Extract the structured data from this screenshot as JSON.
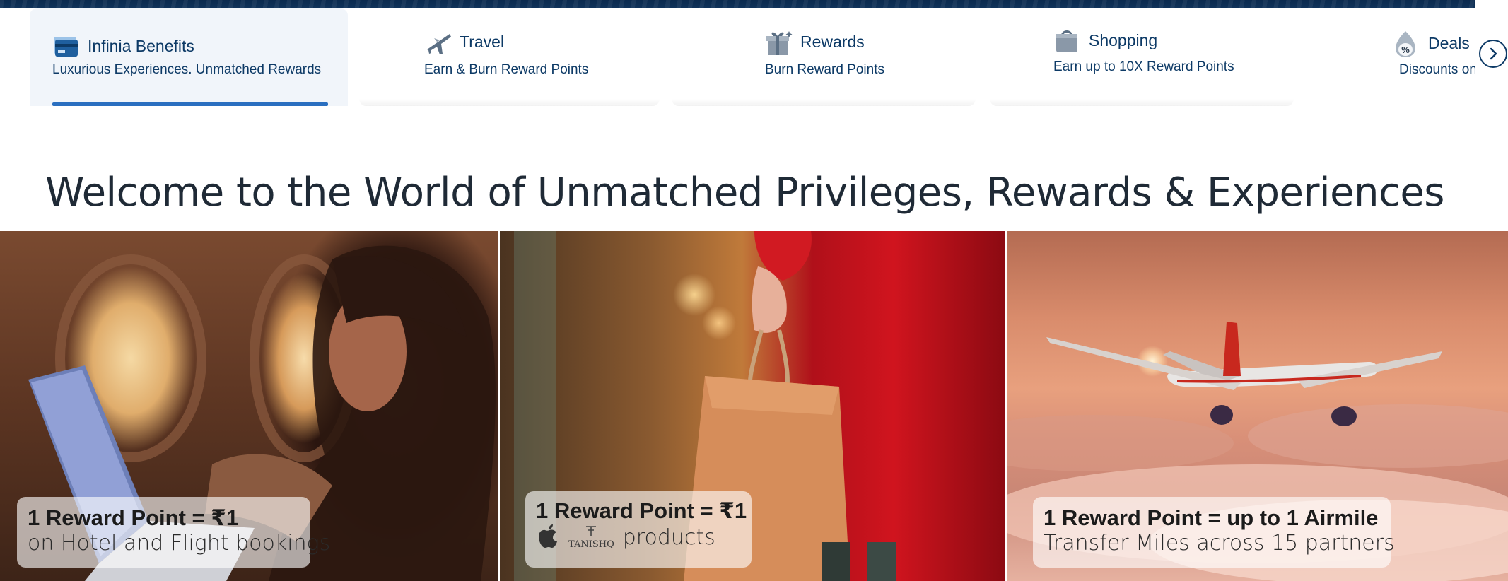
{
  "tabs": [
    {
      "icon": "credit-card-icon",
      "title": "Infinia Benefits",
      "subtitle": "Luxurious Experiences. Unmatched Rewards",
      "active": true
    },
    {
      "icon": "airplane-icon",
      "title": "Travel",
      "subtitle": "Earn & Burn Reward Points",
      "active": false
    },
    {
      "icon": "gift-icon",
      "title": "Rewards",
      "subtitle": "Burn Reward Points",
      "active": false
    },
    {
      "icon": "shopping-bag-icon",
      "title": "Shopping",
      "subtitle": "Earn up to 10X Reward Points",
      "active": false
    },
    {
      "icon": "discount-tag-icon",
      "title": "Deals &",
      "subtitle": "Discounts on",
      "active": false
    }
  ],
  "next_button": {
    "icon": "chevron-right-icon"
  },
  "welcome_heading": "Welcome to the World of Unmatched Privileges, Rewards & Experiences",
  "panels": [
    {
      "headline": "1 Reward Point = ₹1",
      "subline": "on Hotel and Flight bookings"
    },
    {
      "headline": "1 Reward Point = ₹1",
      "subline": "products",
      "brand_logos": [
        "apple-logo",
        "tanishq-logo"
      ],
      "tanishq_text": "TANISHQ"
    },
    {
      "headline": "1 Reward Point = up to 1 Airmile",
      "subline": "Transfer Miles across 15 partners"
    }
  ],
  "colors": {
    "brand_navy": "#0d3a66",
    "tab_active_underline": "#2a6fc0",
    "tab_active_bg": "#f1f5fa"
  }
}
